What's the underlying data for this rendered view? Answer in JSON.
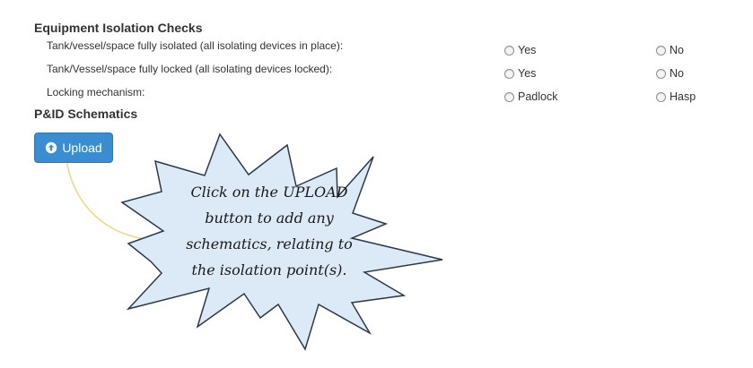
{
  "isolation": {
    "title": "Equipment Isolation Checks",
    "rows": [
      {
        "label": "Tank/vessel/space fully isolated (all isolating devices in place):",
        "opt1": "Yes",
        "opt2": "No"
      },
      {
        "label": "Tank/Vessel/space fully locked (all isolating devices locked):",
        "opt1": "Yes",
        "opt2": "No"
      },
      {
        "label": "Locking mechanism:",
        "opt1": "Padlock",
        "opt2": "Hasp"
      }
    ]
  },
  "schematics": {
    "title": "P&ID Schematics",
    "upload_label": "Upload",
    "upload_icon": "upload-circle-icon",
    "button_color": "#3a8dd1"
  },
  "callout": {
    "lines": [
      "Click on the UPLOAD",
      "button to add any",
      "schematics, relating to",
      "the isolation point(s)."
    ],
    "fill_color": "#dce9f6",
    "border_color": "#2b3a4a",
    "arrow_color": "#f2d98a"
  }
}
